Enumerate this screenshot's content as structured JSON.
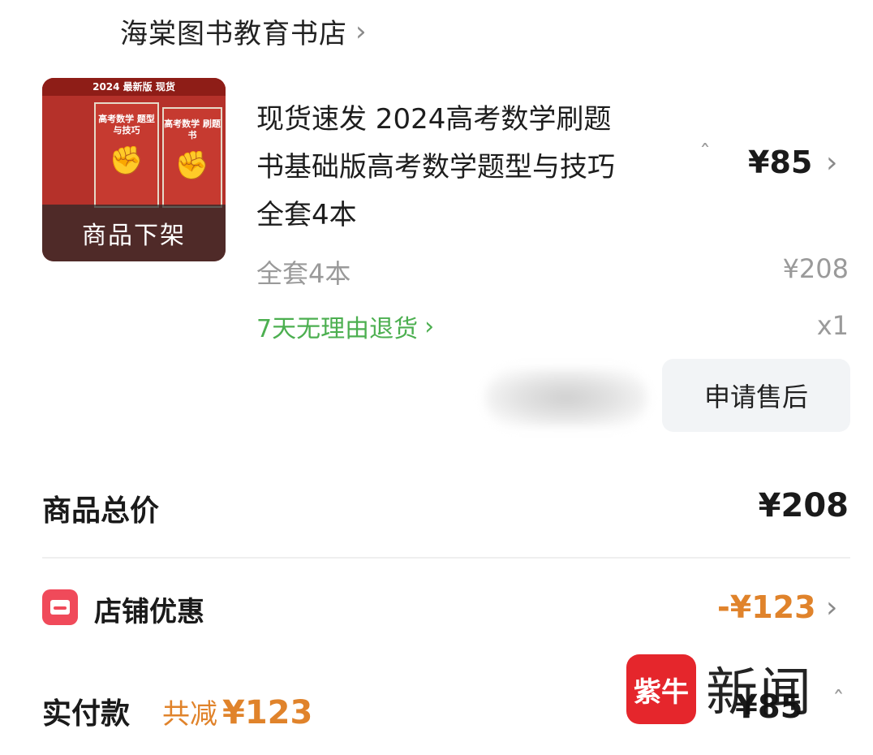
{
  "store": {
    "name": "海棠图书教育书店"
  },
  "product": {
    "thumb": {
      "banner": "2024 最新版 现货",
      "book1_title": "高考数学 题型与技巧",
      "book2_title": "高考数学 刷题书",
      "overlay": "商品下架"
    },
    "title_lines": [
      "现货速发 2024高考数学刷题",
      "书基础版高考数学题型与技巧",
      "全套4本"
    ],
    "price": "¥85",
    "spec": "全套4本",
    "original_price": "¥208",
    "refund_policy": "7天无理由退货",
    "quantity": "x1"
  },
  "actions": {
    "after_sale": "申请售后"
  },
  "summary": {
    "total_label": "商品总价",
    "total_value": "¥208",
    "discount_label": "店铺优惠",
    "discount_value": "-¥123",
    "paid_label": "实付款",
    "saved_prefix": "共减",
    "saved_amount": "¥123",
    "paid_value": "¥85"
  },
  "watermark": {
    "logo": "紫牛",
    "text": "新闻"
  },
  "colors": {
    "discount_orange": "#e0832b",
    "refund_green": "#4caf50",
    "shop_icon_red": "#f04a5a",
    "watermark_red": "#e5262c"
  }
}
